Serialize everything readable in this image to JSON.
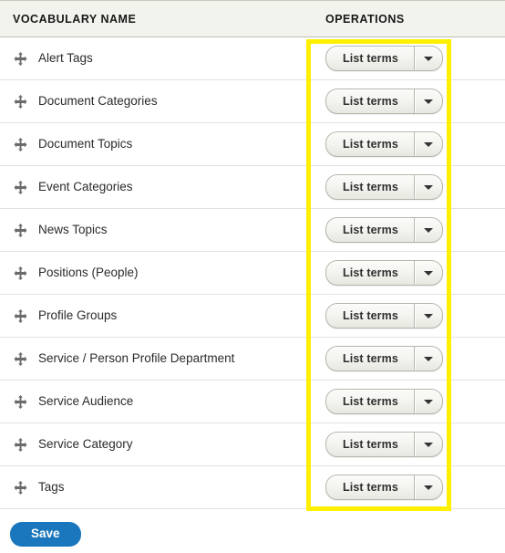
{
  "table": {
    "columns": [
      {
        "key": "name",
        "label": "VOCABULARY NAME"
      },
      {
        "key": "operations",
        "label": "OPERATIONS"
      }
    ],
    "rows": [
      {
        "name": "Alert Tags",
        "operation_label": "List terms"
      },
      {
        "name": "Document Categories",
        "operation_label": "List terms"
      },
      {
        "name": "Document Topics",
        "operation_label": "List terms"
      },
      {
        "name": "Event Categories",
        "operation_label": "List terms"
      },
      {
        "name": "News Topics",
        "operation_label": "List terms"
      },
      {
        "name": "Positions (People)",
        "operation_label": "List terms"
      },
      {
        "name": "Profile Groups",
        "operation_label": "List terms"
      },
      {
        "name": "Service / Person Profile Department",
        "operation_label": "List terms"
      },
      {
        "name": "Service Audience",
        "operation_label": "List terms"
      },
      {
        "name": "Service Category",
        "operation_label": "List terms"
      },
      {
        "name": "Tags",
        "operation_label": "List terms"
      }
    ],
    "row_icon": "drag-move-icon",
    "dropdown_icon": "caret-down-icon"
  },
  "actions": {
    "save_label": "Save"
  },
  "annotation": {
    "type": "highlight-rectangle",
    "color": "#ffef00",
    "target": "operations-column"
  },
  "colors": {
    "header_background": "#f3f3ee",
    "header_text": "#181818",
    "row_border": "#e2e2dc",
    "row_text": "#2b2b2b",
    "button_border": "#b5b5ad",
    "button_text": "#2f2f2f",
    "save_background": "#1a76bd",
    "save_text": "#ffffff",
    "highlight": "#ffef00"
  }
}
